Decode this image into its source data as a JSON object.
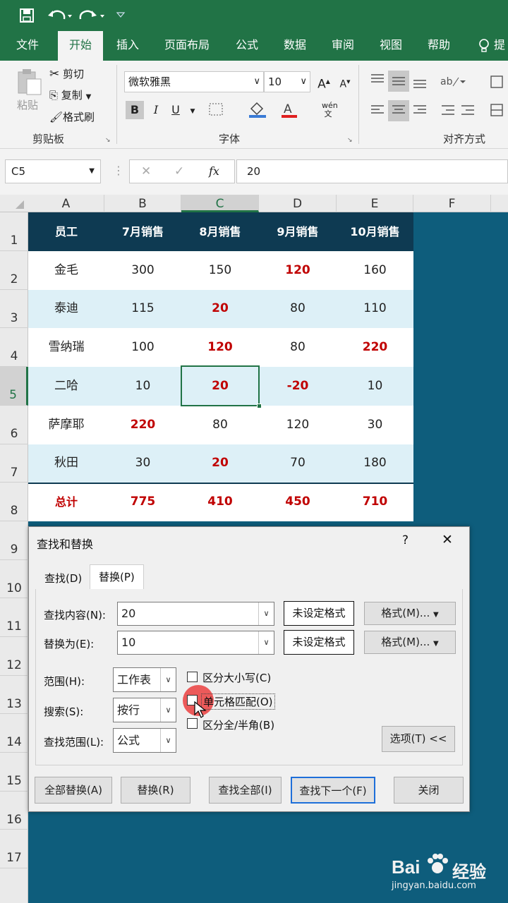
{
  "qat": {
    "save_icon": "save-icon",
    "undo_icon": "undo-icon",
    "redo_icon": "redo-icon",
    "customize_icon": "customize-icon"
  },
  "ribbon_tabs": [
    "文件",
    "开始",
    "插入",
    "页面布局",
    "公式",
    "数据",
    "审阅",
    "视图",
    "帮助",
    "提"
  ],
  "ribbon": {
    "clipboard": {
      "paste": "粘贴",
      "cut": "剪切",
      "copy": "复制",
      "format_painter": "格式刷",
      "group": "剪贴板"
    },
    "font": {
      "name": "微软雅黑",
      "size": "10",
      "group": "字体",
      "bold": "B",
      "italic": "I",
      "underline": "U",
      "grow": "A",
      "shrink": "A"
    },
    "alignment": {
      "group": "对齐方式"
    }
  },
  "formula_bar": {
    "name_box": "C5",
    "cancel": "✕",
    "enter": "✓",
    "fx": "fx",
    "value": "20"
  },
  "columns": [
    "A",
    "B",
    "C",
    "D",
    "E",
    "F"
  ],
  "rows": [
    "1",
    "2",
    "3",
    "4",
    "5",
    "6",
    "7",
    "8",
    "9",
    "10",
    "11",
    "12",
    "13",
    "14",
    "15",
    "16",
    "17"
  ],
  "table": {
    "header": [
      "员工",
      "7月销售",
      "8月销售",
      "9月销售",
      "10月销售"
    ],
    "rows": [
      [
        "金毛",
        "300",
        "150",
        "120",
        "160"
      ],
      [
        "泰迪",
        "115",
        "20",
        "80",
        "110"
      ],
      [
        "雪纳瑞",
        "100",
        "120",
        "80",
        "220"
      ],
      [
        "二哈",
        "10",
        "20",
        "-20",
        "10"
      ],
      [
        "萨摩耶",
        "220",
        "80",
        "120",
        "30"
      ],
      [
        "秋田",
        "30",
        "20",
        "70",
        "180"
      ]
    ],
    "total": [
      "总计",
      "775",
      "410",
      "450",
      "710"
    ],
    "header_bg": "#0e3a52",
    "stripe_bg": "#ddf0f7",
    "red": "#c00000",
    "accent": "#217346"
  },
  "dialog": {
    "title": "查找和替换",
    "help": "?",
    "close": "✕",
    "tab_find": "查找(D)",
    "tab_replace": "替换(P)",
    "find_label": "查找内容(N):",
    "find_value": "20",
    "replace_label": "替换为(E):",
    "replace_value": "10",
    "no_format": "未设定格式",
    "format_btn": "格式(M)...",
    "within_label": "范围(H):",
    "within_value": "工作表",
    "search_label": "搜索(S):",
    "search_value": "按行",
    "lookin_label": "查找范围(L):",
    "lookin_value": "公式",
    "match_case": "区分大小写(C)",
    "match_cell": "单元格匹配(O)",
    "match_width": "区分全/半角(B)",
    "options_btn": "选项(T) <<",
    "replace_all": "全部替换(A)",
    "replace": "替换(R)",
    "find_all": "查找全部(I)",
    "find_next": "查找下一个(F)",
    "close_btn": "关闭"
  },
  "watermark": {
    "brand": "Bai",
    "brand2": "经验",
    "url": "jingyan.baidu.com"
  }
}
